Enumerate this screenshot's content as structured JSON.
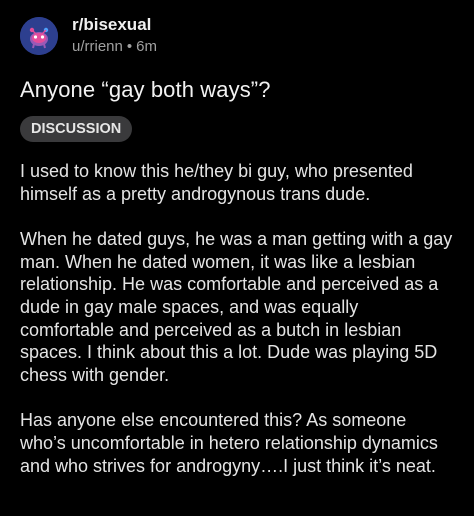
{
  "post": {
    "subreddit": "r/bisexual",
    "author": "u/rrienn",
    "separator": "•",
    "age": "6m",
    "title": "Anyone “gay both ways”?",
    "flair": "DISCUSSION",
    "paragraphs": [
      "I used to know this he/they bi guy, who presented himself as a pretty androgynous trans dude.",
      "When he dated guys, he was a man getting with a gay man. When he dated women, it was like a lesbian relationship. He was comfortable and perceived as a dude in gay male spaces, and was equally comfortable and perceived as a butch in lesbian spaces. I think about this a lot. Dude was playing 5D chess with gender.",
      "Has anyone else encountered this? As someone who’s uncomfortable in hetero relationship dynamics and who strives for androgyny….I just think it’s neat."
    ]
  },
  "icons": {
    "avatar": "subreddit-avatar-icon"
  },
  "colors": {
    "background": "#000000",
    "avatar": "#2d3f8f",
    "flair_bg": "#3a3a3c",
    "muted_text": "#a0a0a0"
  }
}
